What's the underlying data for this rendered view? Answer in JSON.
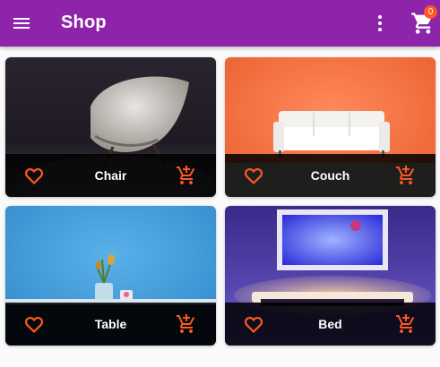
{
  "app_bar": {
    "title": "Shop",
    "menu_icon": "menu-icon",
    "more_icon": "more-vert-icon",
    "cart_icon": "shopping-cart-icon",
    "cart_count": "0",
    "background_color": "#8e24aa",
    "badge_color": "#ff5722"
  },
  "products": [
    {
      "name": "Chair",
      "favorite_icon": "heart-outline-icon",
      "cart_icon": "add-shopping-cart-icon"
    },
    {
      "name": "Couch",
      "favorite_icon": "heart-outline-icon",
      "cart_icon": "add-shopping-cart-icon"
    },
    {
      "name": "Table",
      "favorite_icon": "heart-outline-icon",
      "cart_icon": "add-shopping-cart-icon"
    },
    {
      "name": "Bed",
      "favorite_icon": "heart-outline-icon",
      "cart_icon": "add-shopping-cart-icon"
    }
  ],
  "colors": {
    "accent": "#ff5722",
    "tile_footer": "#000000"
  }
}
